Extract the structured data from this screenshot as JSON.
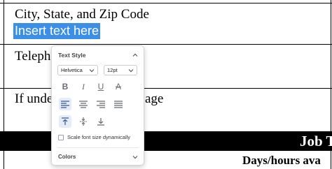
{
  "document": {
    "field1_label": "City, State, and Zip Code",
    "field1_value": "Insert text here",
    "field2_label": "Teleph",
    "field3_label_start": "If unde",
    "field3_label_end": "age",
    "section_header": "Job T",
    "days_text": "Days/hours ava"
  },
  "text_style_panel": {
    "title": "Text Style",
    "font_family": "Helvetica",
    "font_size": "12pt",
    "scale_checkbox_label": "Scale font size dynamically",
    "scale_checkbox_checked": false,
    "colors_label": "Colors",
    "format_buttons": [
      "bold-icon",
      "italic-icon",
      "underline-icon",
      "strikethrough-icon"
    ],
    "align_buttons": [
      "align-left-icon",
      "align-center-icon",
      "align-right-icon",
      "align-justify-icon"
    ],
    "align_selected": "align-left-icon",
    "vertical_buttons": [
      "align-top-icon",
      "align-middle-icon",
      "align-bottom-icon"
    ],
    "vertical_selected": "align-top-icon",
    "accent_color": "#3b8fe6"
  }
}
